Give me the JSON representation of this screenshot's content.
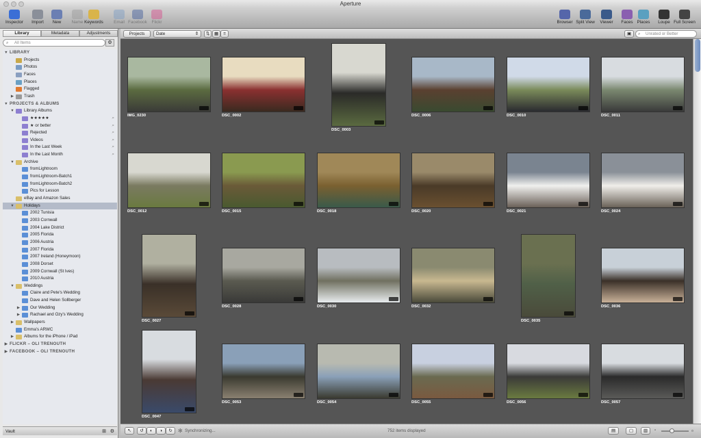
{
  "window": {
    "title": "Aperture"
  },
  "toolbar": {
    "left": [
      {
        "name": "inspector-button",
        "label": "Inspector",
        "icon": "info-icon",
        "color": "#3b6fd6",
        "dim": false
      },
      {
        "name": "import-button",
        "label": "Import",
        "icon": "import-arrow-icon",
        "color": "#8a8f99",
        "dim": false
      },
      {
        "name": "new-button",
        "label": "New",
        "icon": "new-project-icon",
        "color": "#6b7fb3",
        "dim": false
      },
      {
        "name": "name-button",
        "label": "Name",
        "icon": "person-icon",
        "color": "#9a9a9a",
        "dim": true
      },
      {
        "name": "keywords-button",
        "label": "Keywords",
        "icon": "keyword-tag-icon",
        "color": "#d9b44a",
        "dim": false
      },
      {
        "name": "email-button",
        "label": "Email",
        "icon": "email-icon",
        "color": "#7a9cc4",
        "dim": true
      },
      {
        "name": "facebook-button",
        "label": "Facebook",
        "icon": "facebook-icon",
        "color": "#3b5998",
        "dim": true
      },
      {
        "name": "flickr-button",
        "label": "Flickr",
        "icon": "flickr-icon",
        "color": "#d84a8a",
        "dim": true
      }
    ],
    "right": [
      {
        "name": "browser-button",
        "label": "Browser",
        "icon": "browser-grid-icon",
        "color": "#5566aa",
        "dim": false
      },
      {
        "name": "split-view-button",
        "label": "Split View",
        "icon": "split-view-icon",
        "color": "#4a6a9a",
        "dim": false
      },
      {
        "name": "viewer-button",
        "label": "Viewer",
        "icon": "viewer-icon",
        "color": "#3a5a8a",
        "dim": false
      },
      {
        "name": "faces-button",
        "label": "Faces",
        "icon": "faces-icon",
        "color": "#8a5fb0",
        "dim": false
      },
      {
        "name": "places-button",
        "label": "Places",
        "icon": "places-map-icon",
        "color": "#5aa0c0",
        "dim": false
      },
      {
        "name": "loupe-button",
        "label": "Loupe",
        "icon": "loupe-icon",
        "color": "#333333",
        "dim": false
      },
      {
        "name": "full-screen-button",
        "label": "Full Screen",
        "icon": "full-screen-icon",
        "color": "#444444",
        "dim": false
      }
    ]
  },
  "tabs": [
    "Library",
    "Metadata",
    "Adjustments"
  ],
  "sidebar": {
    "search_placeholder": "All Items",
    "items": [
      {
        "label": "LIBRARY",
        "type": "head",
        "indent": 0,
        "tw": "▼"
      },
      {
        "label": "Projects",
        "indent": 1,
        "color": "#c9a94a"
      },
      {
        "label": "Photos",
        "indent": 1,
        "color": "#7a9cc4"
      },
      {
        "label": "Faces",
        "indent": 1,
        "color": "#8a9fc0"
      },
      {
        "label": "Places",
        "indent": 1,
        "color": "#6aa0c4"
      },
      {
        "label": "Flagged",
        "indent": 1,
        "color": "#e07a30"
      },
      {
        "label": "Trash",
        "indent": 1,
        "color": "#9a9a9a",
        "tw": "▶"
      },
      {
        "label": "PROJECTS & ALBUMS",
        "type": "head",
        "indent": 0,
        "tw": "▼"
      },
      {
        "label": "Library Albums",
        "indent": 1,
        "color": "#8d7fd0",
        "tw": "▼"
      },
      {
        "label": "★★★★★",
        "indent": 2,
        "color": "#8d7fd0",
        "smart": true
      },
      {
        "label": "★ or better",
        "indent": 2,
        "color": "#8d7fd0",
        "smart": true
      },
      {
        "label": "Rejected",
        "indent": 2,
        "color": "#8d7fd0",
        "smart": true
      },
      {
        "label": "Videos",
        "indent": 2,
        "color": "#8d7fd0",
        "smart": true
      },
      {
        "label": "In the Last Week",
        "indent": 2,
        "color": "#8d7fd0",
        "smart": true
      },
      {
        "label": "In the Last Month",
        "indent": 2,
        "color": "#8d7fd0",
        "smart": true
      },
      {
        "label": "Archive",
        "indent": 1,
        "color": "#d9bf6a",
        "tw": "▼"
      },
      {
        "label": "fromLightroom",
        "indent": 2,
        "color": "#5b8fd6"
      },
      {
        "label": "fromLightroom-Batch1",
        "indent": 2,
        "color": "#5b8fd6"
      },
      {
        "label": "fromLightroom-Batch2",
        "indent": 2,
        "color": "#5b8fd6"
      },
      {
        "label": "Pics for Lesson",
        "indent": 2,
        "color": "#5b8fd6"
      },
      {
        "label": "eBay and Amazon Sales",
        "indent": 1,
        "color": "#d9bf6a"
      },
      {
        "label": "Holidays",
        "indent": 1,
        "color": "#d9bf6a",
        "tw": "▼",
        "sel": true
      },
      {
        "label": "2002 Tunisia",
        "indent": 2,
        "color": "#5b8fd6"
      },
      {
        "label": "2003 Cornwall",
        "indent": 2,
        "color": "#5b8fd6"
      },
      {
        "label": "2004 Lake District",
        "indent": 2,
        "color": "#5b8fd6"
      },
      {
        "label": "2005 Florida",
        "indent": 2,
        "color": "#5b8fd6"
      },
      {
        "label": "2006 Austria",
        "indent": 2,
        "color": "#5b8fd6"
      },
      {
        "label": "2007 Florida",
        "indent": 2,
        "color": "#5b8fd6"
      },
      {
        "label": "2007 Ireland (Honeymoon)",
        "indent": 2,
        "color": "#5b8fd6"
      },
      {
        "label": "2008 Dorset",
        "indent": 2,
        "color": "#5b8fd6"
      },
      {
        "label": "2009 Cornwall (St Ives)",
        "indent": 2,
        "color": "#5b8fd6"
      },
      {
        "label": "2010 Austria",
        "indent": 2,
        "color": "#5b8fd6"
      },
      {
        "label": "Weddings",
        "indent": 1,
        "color": "#d9bf6a",
        "tw": "▼"
      },
      {
        "label": "Claire and Pete's Wedding",
        "indent": 2,
        "color": "#5b8fd6"
      },
      {
        "label": "Dave and Helen Sollberger",
        "indent": 2,
        "color": "#5b8fd6"
      },
      {
        "label": "Our Wedding",
        "indent": 2,
        "color": "#5b8fd6",
        "tw": "▶"
      },
      {
        "label": "Rachael and Ozy's Wedding",
        "indent": 2,
        "color": "#5b8fd6",
        "tw": "▶"
      },
      {
        "label": "Wallpapers",
        "indent": 1,
        "color": "#d9bf6a",
        "tw": "▶"
      },
      {
        "label": "Emma's ARWC",
        "indent": 1,
        "color": "#5b8fd6"
      },
      {
        "label": "Albums for the iPhone / iPad",
        "indent": 1,
        "color": "#d9bf6a",
        "tw": "▶"
      },
      {
        "label": "FLICKR – OLI TRENOUTH",
        "type": "head",
        "indent": 0,
        "tw": "▶"
      },
      {
        "label": "FACEBOOK – OLI TRENOUTH",
        "type": "head",
        "indent": 0,
        "tw": "▶"
      }
    ],
    "vault_label": "Vault"
  },
  "browse_bar": {
    "projects_button": "Projects",
    "sort_value": "Date",
    "filter_value": "Unrated or Better"
  },
  "photos": [
    {
      "name": "IMG_0230",
      "orient": "l",
      "colors": [
        "#a9b8a0",
        "#5b6b40",
        "#3b3b38"
      ]
    },
    {
      "name": "DSC_0002",
      "orient": "l",
      "colors": [
        "#e8dcc0",
        "#8a3030",
        "#3a2a20"
      ]
    },
    {
      "name": "DSC_0003",
      "orient": "p",
      "colors": [
        "#d8d8d0",
        "#2a2a28",
        "#5a6a40"
      ]
    },
    {
      "name": "DSC_0006",
      "orient": "l",
      "colors": [
        "#a8b8c8",
        "#5a4030",
        "#3a4a30"
      ]
    },
    {
      "name": "DSC_0010",
      "orient": "l",
      "colors": [
        "#d0dae8",
        "#7a8a5a",
        "#2a2a30"
      ]
    },
    {
      "name": "DSC_0011",
      "orient": "l",
      "colors": [
        "#d8dce0",
        "#7a8870",
        "#3a3a3a"
      ]
    },
    {
      "name": "DSC_0012",
      "orient": "l",
      "colors": [
        "#d8d8d0",
        "#7a7a60",
        "#6a7a40"
      ]
    },
    {
      "name": "DSC_0015",
      "orient": "l",
      "colors": [
        "#8a9a50",
        "#6a5a38",
        "#4a5a30"
      ]
    },
    {
      "name": "DSC_0018",
      "orient": "l",
      "colors": [
        "#a08858",
        "#7a6030",
        "#3a5a4a"
      ]
    },
    {
      "name": "DSC_0020",
      "orient": "l",
      "colors": [
        "#9a8a6a",
        "#4a3a28",
        "#6a5030"
      ]
    },
    {
      "name": "DSC_0021",
      "orient": "l",
      "colors": [
        "#7a8490",
        "#f0f0ee",
        "#6a6058"
      ]
    },
    {
      "name": "DSC_0024",
      "orient": "l",
      "colors": [
        "#8a9098",
        "#f0eeea",
        "#6a6258"
      ]
    },
    {
      "name": "DSC_0027",
      "orient": "p",
      "colors": [
        "#b0b0a0",
        "#3a3028",
        "#5a4a38"
      ]
    },
    {
      "name": "DSC_0028",
      "orient": "l",
      "colors": [
        "#a8a8a0",
        "#5a5a50",
        "#3a3a38"
      ]
    },
    {
      "name": "DSC_0030",
      "orient": "l",
      "colors": [
        "#b8bcc0",
        "#707060",
        "#e8ecee"
      ]
    },
    {
      "name": "DSC_0032",
      "orient": "l",
      "colors": [
        "#8a8a70",
        "#c8b890",
        "#4a4a3a"
      ]
    },
    {
      "name": "DSC_0035",
      "orient": "p",
      "colors": [
        "#6a7050",
        "#506048",
        "#4a4a3a"
      ]
    },
    {
      "name": "DSC_0036",
      "orient": "l",
      "colors": [
        "#c8d0d8",
        "#3a3028",
        "#c8b098"
      ]
    },
    {
      "name": "DSC_0047",
      "orient": "p",
      "colors": [
        "#d8dce0",
        "#4a3a34",
        "#3a4a6a"
      ]
    },
    {
      "name": "DSC_0053",
      "orient": "l",
      "colors": [
        "#8aa0b8",
        "#3a3a30",
        "#8a8070"
      ]
    },
    {
      "name": "DSC_0054",
      "orient": "l",
      "colors": [
        "#b8bab0",
        "#8aa0b8",
        "#3a3a30"
      ]
    },
    {
      "name": "DSC_0055",
      "orient": "l",
      "colors": [
        "#c8d0e0",
        "#6a6a50",
        "#7a5a40"
      ]
    },
    {
      "name": "DSC_0056",
      "orient": "l",
      "colors": [
        "#d8dae0",
        "#3a3a38",
        "#6a7a40"
      ]
    },
    {
      "name": "DSC_0057",
      "orient": "l",
      "colors": [
        "#d8dce0",
        "#2a2a2a",
        "#5a5a58"
      ]
    }
  ],
  "status": {
    "sync_text": "Synchronizing...",
    "count_text": "752 items displayed"
  }
}
